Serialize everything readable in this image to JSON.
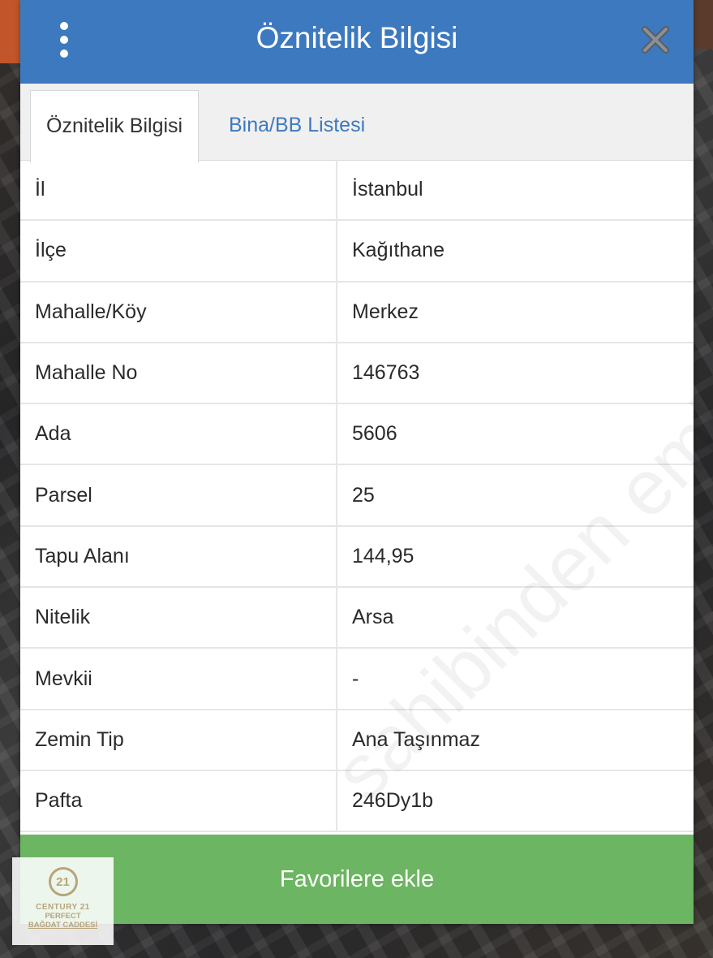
{
  "dialog": {
    "title": "Öznitelik Bilgisi",
    "menu_icon": "kebab-menu-icon",
    "close_icon": "close-icon"
  },
  "tabs": [
    {
      "label": "Öznitelik Bilgisi",
      "active": true
    },
    {
      "label": "Bina/BB Listesi",
      "active": false
    }
  ],
  "rows": [
    {
      "label": "İl",
      "value": "İstanbul"
    },
    {
      "label": "İlçe",
      "value": "Kağıthane"
    },
    {
      "label": "Mahalle/Köy",
      "value": "Merkez"
    },
    {
      "label": "Mahalle No",
      "value": "146763"
    },
    {
      "label": "Ada",
      "value": "5606"
    },
    {
      "label": "Parsel",
      "value": "25"
    },
    {
      "label": "Tapu Alanı",
      "value": "144,95"
    },
    {
      "label": "Nitelik",
      "value": "Arsa"
    },
    {
      "label": "Mevkii",
      "value": "-"
    },
    {
      "label": "Zemin Tip",
      "value": "Ana Taşınmaz"
    },
    {
      "label": "Pafta",
      "value": "246Dy1b"
    }
  ],
  "favorite_button": {
    "label": "Favorilere ekle"
  },
  "watermark": {
    "text": "sahibinden emlakjet.com"
  },
  "logo": {
    "mark": "21",
    "line1": "CENTURY 21",
    "line2": "PERFECT",
    "line3": "BAĞDAT CADDESİ"
  },
  "colors": {
    "header": "#3d79bf",
    "button": "#6cb562",
    "tab_link": "#3d79bf"
  }
}
